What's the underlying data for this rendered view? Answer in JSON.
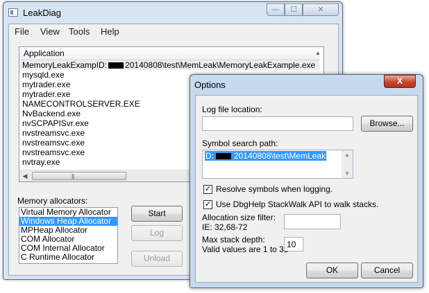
{
  "main_window": {
    "title": "LeakDiag",
    "menu": [
      "File",
      "View",
      "Tools",
      "Help"
    ],
    "minimize_glyph": "—",
    "maximize_glyph": "☐",
    "close_glyph": "✕"
  },
  "applications": {
    "header": "Application",
    "rows": [
      "MemoryLeakExampID:",
      "mysqld.exe",
      "mytrader.exe",
      "mytrader.exe",
      "NAMECONTROLSERVER.EXE",
      "NvBackend.exe",
      "nvSCPAPISvr.exe",
      "nvstreamsvc.exe",
      "nvstreamsvc.exe",
      "nvstreamsvc.exe",
      "nvtray.exe"
    ],
    "first_row_suffix": "20140808\\test\\MemLeak\\MemoryLeakExample.exe",
    "selected_index": 0
  },
  "allocators": {
    "label": "Memory allocators:",
    "items": [
      "Virtual Memory Allocator",
      "Windows Heap Allocator",
      "MPHeap Allocator",
      "COM Allocator",
      "COM Internal Allocator",
      "C Runtime Allocator"
    ],
    "selected_index": 1
  },
  "actions": {
    "start": "Start",
    "log": "Log",
    "unload": "Unload"
  },
  "options_dialog": {
    "title": "Options",
    "close_glyph": "X",
    "log_file_label": "Log file location:",
    "log_file_value": "",
    "browse_button": "Browse...",
    "symbol_path_label": "Symbol search path:",
    "symbol_path_prefix": "D:",
    "symbol_path_suffix": "20140808\\test\\MemLeak",
    "resolve_symbols_label": "Resolve symbols when logging.",
    "resolve_symbols_checked": true,
    "stackwalk_label": "Use DbgHelp StackWalk API to walk stacks.",
    "stackwalk_checked": true,
    "alloc_filter_label": "Allocation size filter:",
    "alloc_filter_hint": "IE: 32,68-72",
    "alloc_filter_value": "",
    "max_depth_label": "Max stack depth:",
    "max_depth_hint": "Valid values are 1 to 32",
    "max_depth_value": "10",
    "ok_button": "OK",
    "cancel_button": "Cancel"
  }
}
